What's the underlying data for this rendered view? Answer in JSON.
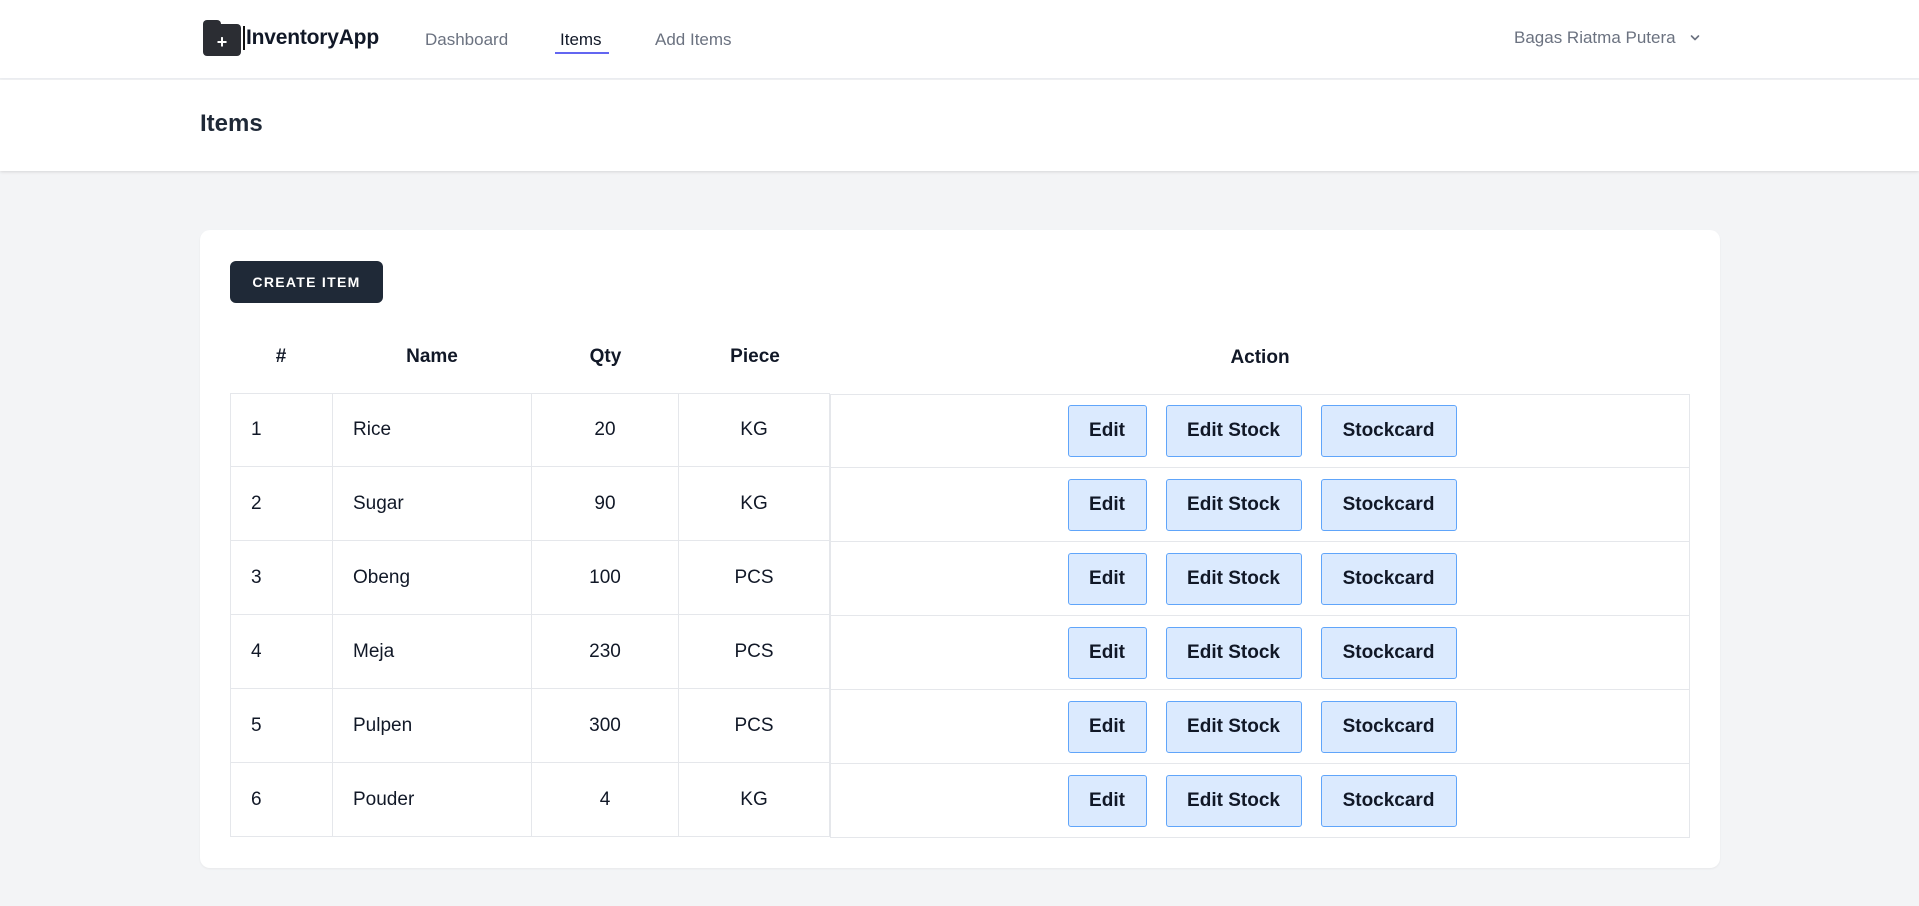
{
  "app": {
    "name": "InventoryApp",
    "logo_icon": "folder-plus-icon"
  },
  "nav": {
    "links": [
      {
        "label": "Dashboard",
        "active": false
      },
      {
        "label": "Items",
        "active": true
      },
      {
        "label": "Add Items",
        "active": false
      }
    ],
    "accent_color": "#6366f1"
  },
  "user": {
    "name": "Bagas Riatma Putera",
    "icon": "chevron-down-icon"
  },
  "header": {
    "title": "Items"
  },
  "toolbar": {
    "create_label": "CREATE ITEM"
  },
  "table": {
    "columns": [
      "#",
      "Name",
      "Qty",
      "Piece",
      "Action"
    ],
    "action_labels": {
      "edit": "Edit",
      "edit_stock": "Edit Stock",
      "stockcard": "Stockcard"
    },
    "rows": [
      {
        "num": "1",
        "name": "Rice",
        "qty": "20",
        "piece": "KG"
      },
      {
        "num": "2",
        "name": "Sugar",
        "qty": "90",
        "piece": "KG"
      },
      {
        "num": "3",
        "name": "Obeng",
        "qty": "100",
        "piece": "PCS"
      },
      {
        "num": "4",
        "name": "Meja",
        "qty": "230",
        "piece": "PCS"
      },
      {
        "num": "5",
        "name": "Pulpen",
        "qty": "300",
        "piece": "PCS"
      },
      {
        "num": "6",
        "name": "Pouder",
        "qty": "4",
        "piece": "KG"
      }
    ]
  },
  "colors": {
    "primary_dark": "#1f2937",
    "button_bg": "#dbeafe",
    "button_border": "#60a5fa",
    "page_bg": "#f3f4f6"
  }
}
